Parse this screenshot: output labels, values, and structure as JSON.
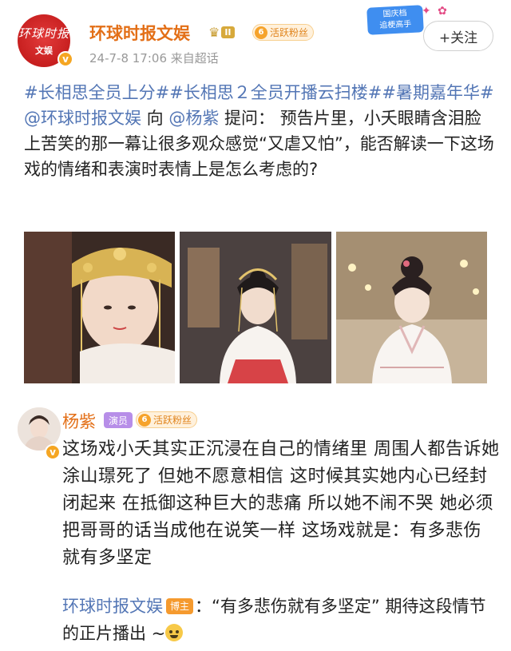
{
  "post": {
    "author_name": "环球时报文娱",
    "avatar_logo_line1": "环球时报",
    "avatar_logo_line2": "文娱",
    "crown_level": "II",
    "fan_badge_num": "6",
    "fan_badge_text": "活跃粉丝",
    "timestamp": "24-7-8 17:06",
    "source": "来自超话",
    "follow_label": "+关注",
    "sticker_text_line1": "国庆档",
    "sticker_text_line2": "追梗高手",
    "body": {
      "tag1": "#长相思全员上分#",
      "tag2": "#长相思２全员开播云扫楼#",
      "tag3": "#暑期嘉年华#",
      "mention_author": "@环球时报文娱",
      "to_word": " 向",
      "mention_target": "@杨紫",
      "question": " 提问： 预告片里，小夭眼睛含泪脸上苦笑的那一幕让很多观众感觉“又虐又怕”，能否解读一下这场戏的情绪和表演时表情上是怎么考虑的?"
    }
  },
  "reply": {
    "name": "杨紫",
    "role_badge": "演员",
    "fan_badge_num": "6",
    "fan_badge_text": "活跃粉丝",
    "text": "这场戏小夭其实正沉浸在自己的情绪里 周围人都告诉她涂山璟死了 但她不愿意相信 这时候其实她内心已经封闭起来 在抵御这种巨大的悲痛 所以她不闹不哭 她必须把哥哥的话当成他在说笑一样 这场戏就是：有多悲伤 就有多坚定"
  },
  "sub_reply": {
    "name": "环球时报文娱",
    "badge": "博主",
    "text": "：“有多悲伤就有多坚定” 期待这段情节的正片播出 ~"
  },
  "colors": {
    "name_orange": "#e36f17",
    "link_blue": "#5376b5",
    "brand_red": "#d42020"
  },
  "icons": [
    "crown-icon",
    "verify-icon",
    "emoji-icon"
  ]
}
